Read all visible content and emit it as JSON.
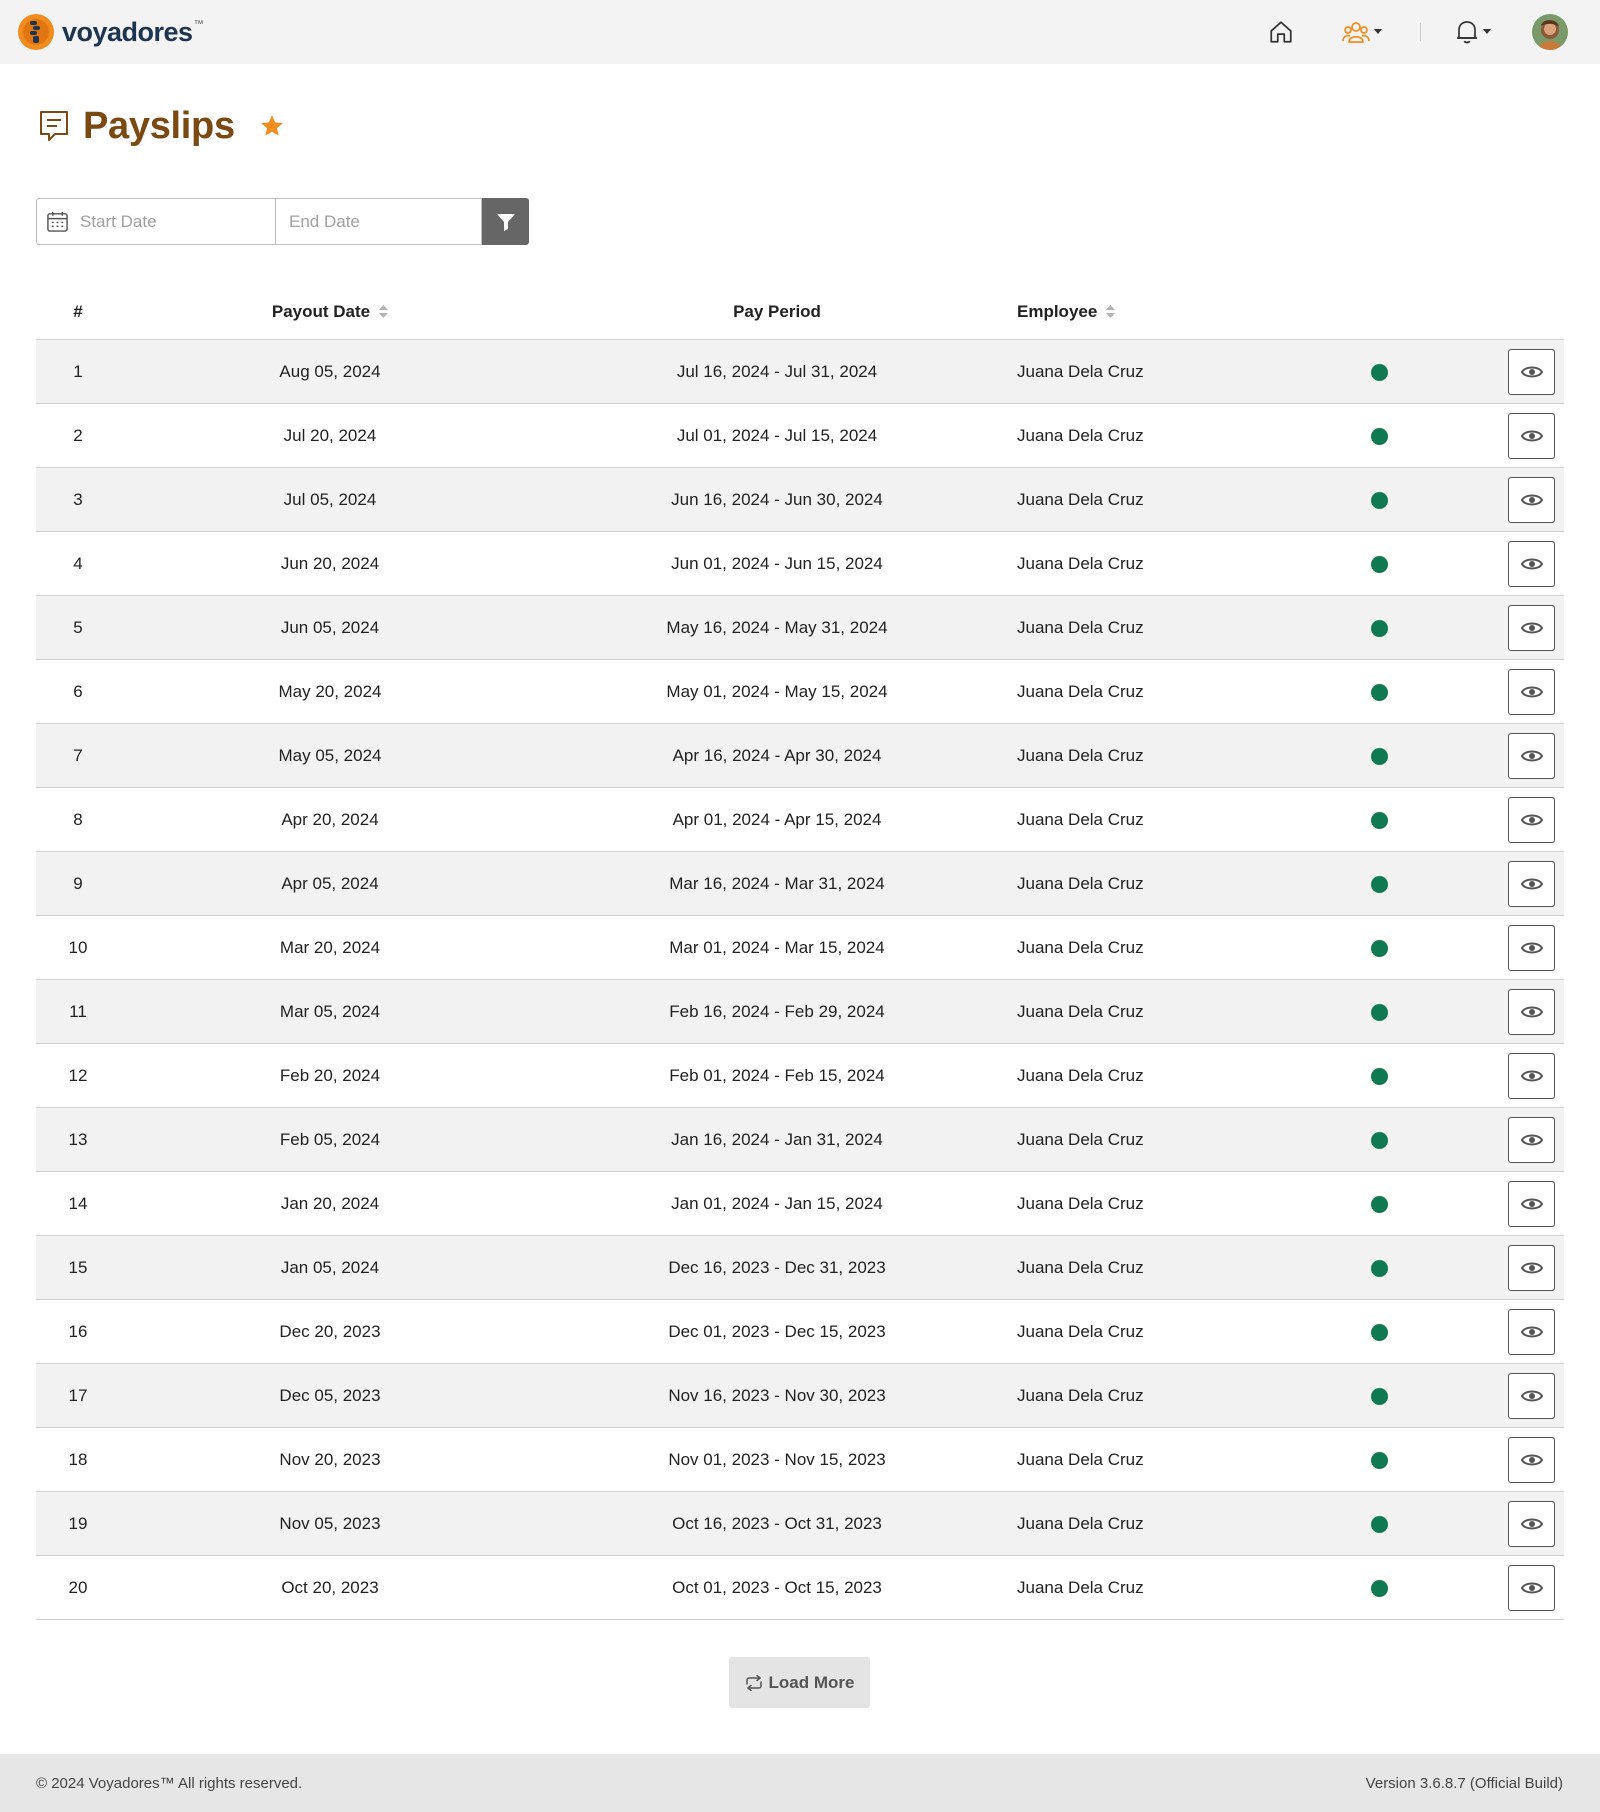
{
  "header": {
    "brand_name": "voyadores",
    "brand_tm": "™"
  },
  "page": {
    "title": "Payslips"
  },
  "filters": {
    "start_placeholder": "Start Date",
    "end_placeholder": "End Date"
  },
  "table": {
    "columns": {
      "num": "#",
      "payout_date": "Payout Date",
      "pay_period": "Pay Period",
      "employee": "Employee"
    },
    "rows": [
      {
        "num": "1",
        "payout_date": "Aug 05, 2024",
        "pay_period": "Jul 16, 2024 - Jul 31, 2024",
        "employee": "Juana Dela Cruz"
      },
      {
        "num": "2",
        "payout_date": "Jul 20, 2024",
        "pay_period": "Jul 01, 2024 - Jul 15, 2024",
        "employee": "Juana Dela Cruz"
      },
      {
        "num": "3",
        "payout_date": "Jul 05, 2024",
        "pay_period": "Jun 16, 2024 - Jun 30, 2024",
        "employee": "Juana Dela Cruz"
      },
      {
        "num": "4",
        "payout_date": "Jun 20, 2024",
        "pay_period": "Jun 01, 2024 - Jun 15, 2024",
        "employee": "Juana Dela Cruz"
      },
      {
        "num": "5",
        "payout_date": "Jun 05, 2024",
        "pay_period": "May 16, 2024 - May 31, 2024",
        "employee": "Juana Dela Cruz"
      },
      {
        "num": "6",
        "payout_date": "May 20, 2024",
        "pay_period": "May 01, 2024 - May 15, 2024",
        "employee": "Juana Dela Cruz"
      },
      {
        "num": "7",
        "payout_date": "May 05, 2024",
        "pay_period": "Apr 16, 2024 - Apr 30, 2024",
        "employee": "Juana Dela Cruz"
      },
      {
        "num": "8",
        "payout_date": "Apr 20, 2024",
        "pay_period": "Apr 01, 2024 - Apr 15, 2024",
        "employee": "Juana Dela Cruz"
      },
      {
        "num": "9",
        "payout_date": "Apr 05, 2024",
        "pay_period": "Mar 16, 2024 - Mar 31, 2024",
        "employee": "Juana Dela Cruz"
      },
      {
        "num": "10",
        "payout_date": "Mar 20, 2024",
        "pay_period": "Mar 01, 2024 - Mar 15, 2024",
        "employee": "Juana Dela Cruz"
      },
      {
        "num": "11",
        "payout_date": "Mar 05, 2024",
        "pay_period": "Feb 16, 2024 - Feb 29, 2024",
        "employee": "Juana Dela Cruz"
      },
      {
        "num": "12",
        "payout_date": "Feb 20, 2024",
        "pay_period": "Feb 01, 2024 - Feb 15, 2024",
        "employee": "Juana Dela Cruz"
      },
      {
        "num": "13",
        "payout_date": "Feb 05, 2024",
        "pay_period": "Jan 16, 2024 - Jan 31, 2024",
        "employee": "Juana Dela Cruz"
      },
      {
        "num": "14",
        "payout_date": "Jan 20, 2024",
        "pay_period": "Jan 01, 2024 - Jan 15, 2024",
        "employee": "Juana Dela Cruz"
      },
      {
        "num": "15",
        "payout_date": "Jan 05, 2024",
        "pay_period": "Dec 16, 2023 - Dec 31, 2023",
        "employee": "Juana Dela Cruz"
      },
      {
        "num": "16",
        "payout_date": "Dec 20, 2023",
        "pay_period": "Dec 01, 2023 - Dec 15, 2023",
        "employee": "Juana Dela Cruz"
      },
      {
        "num": "17",
        "payout_date": "Dec 05, 2023",
        "pay_period": "Nov 16, 2023 - Nov 30, 2023",
        "employee": "Juana Dela Cruz"
      },
      {
        "num": "18",
        "payout_date": "Nov 20, 2023",
        "pay_period": "Nov 01, 2023 - Nov 15, 2023",
        "employee": "Juana Dela Cruz"
      },
      {
        "num": "19",
        "payout_date": "Nov 05, 2023",
        "pay_period": "Oct 16, 2023 - Oct 31, 2023",
        "employee": "Juana Dela Cruz"
      },
      {
        "num": "20",
        "payout_date": "Oct 20, 2023",
        "pay_period": "Oct 01, 2023 - Oct 15, 2023",
        "employee": "Juana Dela Cruz"
      }
    ]
  },
  "load_more": {
    "label": "Load More"
  },
  "footer": {
    "copyright": "© 2024 Voyadores™ All rights reserved.",
    "version": "Version 3.6.8.7 (Official Build)"
  },
  "colors": {
    "title": "#7a4a12",
    "brand": "#1e3550",
    "accent": "#f28c1e",
    "status_active": "#0f7a52"
  },
  "icons": {
    "home": "home-icon",
    "team": "team-icon",
    "bell": "bell-icon",
    "title": "payslip-icon",
    "favorite": "star-icon",
    "calendar": "calendar-icon",
    "filter": "filter-icon",
    "sort": "sort-icon",
    "view": "eye-icon",
    "load_more": "repeat-icon"
  }
}
